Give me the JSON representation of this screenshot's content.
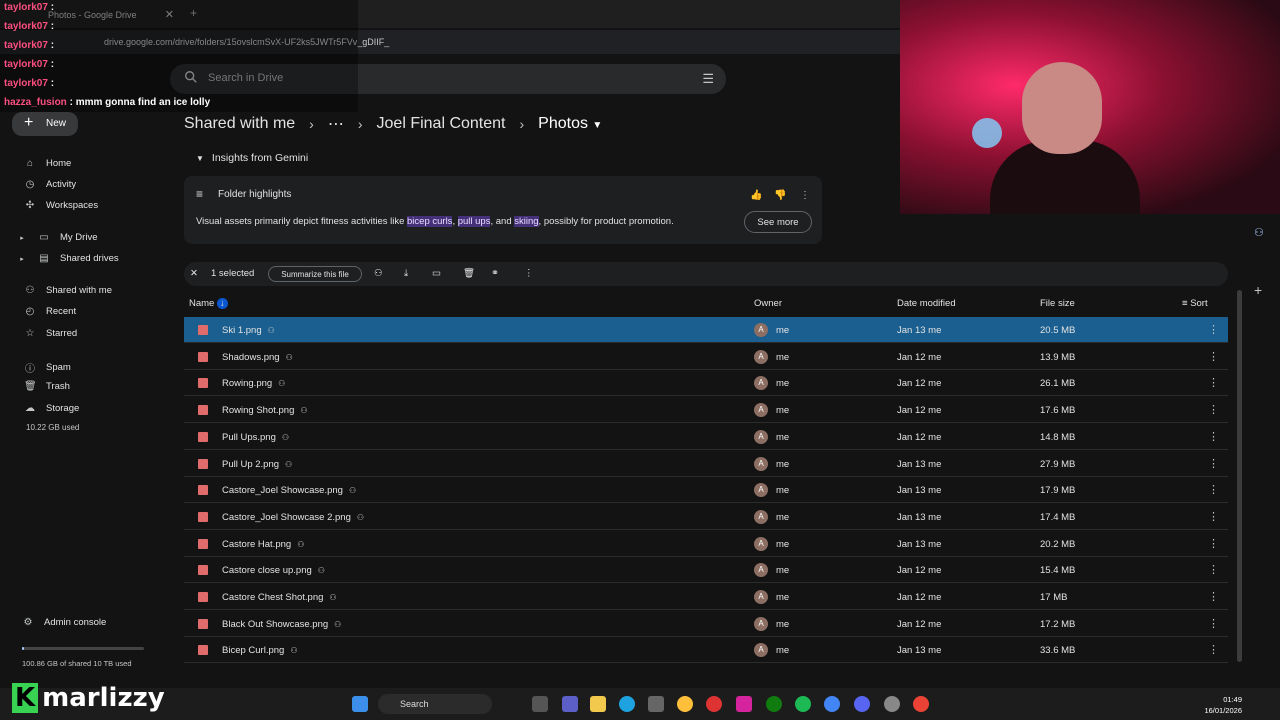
{
  "browser": {
    "tab_title": "Photos - Google Drive",
    "url": "drive.google.com/drive/folders/15ovslcmSvX-UF2ks5JWTr5FVv_gDIIF_"
  },
  "drive": {
    "search_placeholder": "Search in Drive",
    "new_label": "New",
    "nav": [
      {
        "label": "Home",
        "icon": "home-icon"
      },
      {
        "label": "Activity",
        "icon": "activity-icon"
      },
      {
        "label": "Workspaces",
        "icon": "workspaces-icon"
      },
      {
        "label": "My Drive",
        "icon": "drive-icon"
      },
      {
        "label": "Shared drives",
        "icon": "shared-drives-icon"
      },
      {
        "label": "Shared with me",
        "icon": "people-icon"
      },
      {
        "label": "Recent",
        "icon": "clock-icon"
      },
      {
        "label": "Starred",
        "icon": "star-icon"
      },
      {
        "label": "Spam",
        "icon": "spam-icon"
      },
      {
        "label": "Trash",
        "icon": "trash-icon"
      },
      {
        "label": "Storage",
        "icon": "cloud-icon"
      }
    ],
    "storage_used": "10.22 GB used",
    "admin_console": "Admin console",
    "quota_text": "100.86 GB of shared 10 TB used",
    "quota_fraction": 0.01,
    "breadcrumb": [
      "Shared with me",
      "Joel Final Content",
      "Photos"
    ],
    "insights_title": "Insights from Gemini",
    "card": {
      "heading": "Folder highlights",
      "text_before": "Visual assets primarily depict fitness activities like ",
      "hl1": "bicep curls",
      "comma1": ", ",
      "hl2": "pull ups",
      "and": ", and ",
      "hl3": "skiing",
      "text_after": ", possibly for product promotion.",
      "see_more": "See more"
    },
    "selection": {
      "count": "1 selected",
      "summarize": "Summarize this file"
    },
    "columns": {
      "name": "Name",
      "owner": "Owner",
      "modified": "Date modified",
      "size": "File size",
      "sort": "Sort"
    },
    "files": [
      {
        "name": "Ski 1.png",
        "owner": "me",
        "date": "Jan 13 me",
        "size": "20.5 MB"
      },
      {
        "name": "Shadows.png",
        "owner": "me",
        "date": "Jan 12 me",
        "size": "13.9 MB"
      },
      {
        "name": "Rowing.png",
        "owner": "me",
        "date": "Jan 12 me",
        "size": "26.1 MB"
      },
      {
        "name": "Rowing Shot.png",
        "owner": "me",
        "date": "Jan 12 me",
        "size": "17.6 MB"
      },
      {
        "name": "Pull Ups.png",
        "owner": "me",
        "date": "Jan 12 me",
        "size": "14.8 MB"
      },
      {
        "name": "Pull Up 2.png",
        "owner": "me",
        "date": "Jan 13 me",
        "size": "27.9 MB"
      },
      {
        "name": "Castore_Joel Showcase.png",
        "owner": "me",
        "date": "Jan 13 me",
        "size": "17.9 MB"
      },
      {
        "name": "Castore_Joel Showcase 2.png",
        "owner": "me",
        "date": "Jan 13 me",
        "size": "17.4 MB"
      },
      {
        "name": "Castore Hat.png",
        "owner": "me",
        "date": "Jan 13 me",
        "size": "20.2 MB"
      },
      {
        "name": "Castore close up.png",
        "owner": "me",
        "date": "Jan 12 me",
        "size": "15.4 MB"
      },
      {
        "name": "Castore Chest Shot.png",
        "owner": "me",
        "date": "Jan 12 me",
        "size": "17 MB"
      },
      {
        "name": "Black Out Showcase.png",
        "owner": "me",
        "date": "Jan 12 me",
        "size": "17.2 MB"
      },
      {
        "name": "Bicep Curl.png",
        "owner": "me",
        "date": "Jan 13 me",
        "size": "33.6 MB"
      }
    ]
  },
  "chat": [
    {
      "user": "taylork07",
      "msg": ""
    },
    {
      "user": "taylork07",
      "msg": ""
    },
    {
      "user": "taylork07",
      "msg": ""
    },
    {
      "user": "taylork07",
      "msg": ""
    },
    {
      "user": "taylork07",
      "msg": ""
    },
    {
      "user": "hazza_fusion",
      "msg": "mmm gonna find an ice lolly"
    }
  ],
  "stream": {
    "channel": "marlizzy"
  },
  "taskbar": {
    "search": "Search",
    "time": "01:49",
    "date": "16/01/2026"
  }
}
